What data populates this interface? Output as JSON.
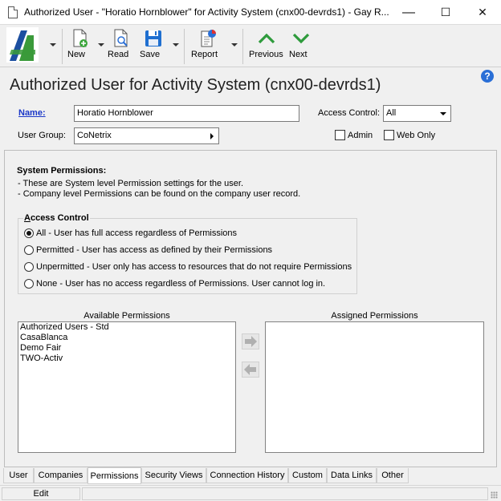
{
  "window": {
    "title": "Authorized User - \"Horatio Hornblower\" for Activity System (cnx00-devrds1) - Gay R...",
    "minimize": "—",
    "maximize": "☐",
    "close": "✕"
  },
  "toolbar": {
    "new_label": "New",
    "read_label": "Read",
    "save_label": "Save",
    "report_label": "Report",
    "previous_label": "Previous",
    "next_label": "Next"
  },
  "header": {
    "title": "Authorized User for Activity System (cnx00-devrds1)",
    "help": "?"
  },
  "form": {
    "name_label": "Name:",
    "name_value": "Horatio Hornblower",
    "access_control_label": "Access Control:",
    "access_control_value": "All",
    "user_group_label": "User Group:",
    "user_group_value": "CoNetrix",
    "admin_label": "Admin",
    "web_only_label": "Web Only"
  },
  "permissions": {
    "title": "System Permissions:",
    "lines": [
      "- These are System level Permission settings for the user.",
      "- Company level Permissions can be found on the company user record."
    ],
    "access_group_label_prefix": "A",
    "access_group_label_rest": "ccess Control",
    "options": [
      {
        "label": "All - User has full access regardless of Permissions",
        "selected": true
      },
      {
        "label": "Permitted - User has access as defined by their Permissions",
        "selected": false
      },
      {
        "label": "Unpermitted - User only has access to resources that do not require Permissions",
        "selected": false
      },
      {
        "label": "None - User has no access regardless of Permissions. User cannot log in.",
        "selected": false
      }
    ],
    "available_header": "Available Permissions",
    "assigned_header": "Assigned Permissions",
    "available": [
      "Authorized Users - Std",
      "CasaBlanca",
      "Demo Fair",
      "TWO-Activ"
    ],
    "assigned": []
  },
  "tabs": [
    "User",
    "Companies",
    "Permissions",
    "Security Views",
    "Connection History",
    "Custom",
    "Data Links",
    "Other"
  ],
  "active_tab": "Permissions",
  "status": {
    "mode": "Edit"
  },
  "colors": {
    "brand_green": "#3a9a3a",
    "brand_blue": "#1c4fa0",
    "name_label": "#1a37c8",
    "help_icon": "#2a6fd6"
  }
}
